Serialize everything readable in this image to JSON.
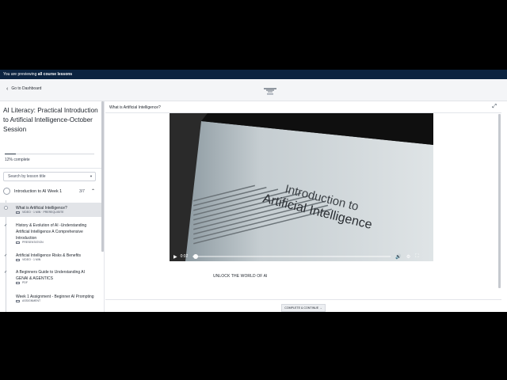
{
  "preview_bar": {
    "prefix": "You are previewing",
    "emphasis": "all course lessons"
  },
  "header": {
    "back_label": "Go to Dashboard",
    "logo": "brand-logo"
  },
  "course": {
    "title": "AI Literacy: Practical Introduction to Artificial Intelligence-October Session",
    "progress_text": "12% complete",
    "progress_value": 0.12
  },
  "search": {
    "placeholder": "Search by lesson title"
  },
  "section": {
    "name": "Introduction to AI Week 1",
    "count": "3/7"
  },
  "lessons": [
    {
      "title": "What is Artificial Intelligence?",
      "meta": "VIDEO · 1 MIN · PREREQUISITE",
      "status": "current"
    },
    {
      "title": "History & Evolution of AI -Understanding Artificial Intelligence A Comprehensive Introduction",
      "meta": "PRESENTATION",
      "status": "done"
    },
    {
      "title": "Artificial Intelligence Risks & Benefits",
      "meta": "VIDEO · 1 MIN",
      "status": "done"
    },
    {
      "title": "A Beginners Guide to Understanding AI GENAI & AGENTICS",
      "meta": "PDF",
      "status": "done"
    },
    {
      "title": "Week 1 Assignment - Beginner AI Prompting",
      "meta": "ASSIGNMENT",
      "status": "todo"
    }
  ],
  "main": {
    "lesson_title": "What is Artificial Intelligence?",
    "video": {
      "book_title_line1": "Introduction to",
      "book_title_line2": "Artificial Intelligence",
      "time": "0:02",
      "progress": 0.01
    },
    "unlock_text": "UNLOCK THE WORLD OF AI",
    "complete_label": "COMPLETE & CONTINUE"
  },
  "colors": {
    "preview_bar": "#0b2340",
    "accent": "#2b3948"
  }
}
